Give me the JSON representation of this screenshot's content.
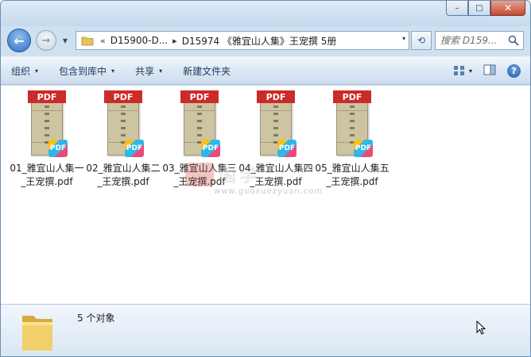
{
  "window": {
    "caption": {
      "minimize": "–",
      "maximize": "□",
      "close": "✕"
    }
  },
  "nav": {
    "back_glyph": "←",
    "forward_glyph": "→",
    "history_glyph": "▼"
  },
  "address": {
    "overflow": "«",
    "breadcrumbs": [
      "D15900-D...",
      "D15974 《雅宜山人集》王宠撰 5册"
    ],
    "separator": "▸",
    "dropdown_glyph": "▾"
  },
  "refresh_glyph": "⟲",
  "search": {
    "placeholder": "搜索 D159..."
  },
  "toolbar": {
    "items": [
      {
        "label": "组织",
        "has_dropdown": true
      },
      {
        "label": "包含到库中",
        "has_dropdown": true
      },
      {
        "label": "共享",
        "has_dropdown": true
      },
      {
        "label": "新建文件夹",
        "has_dropdown": false
      }
    ],
    "view_dropdown_glyph": "▾",
    "help_glyph": "?"
  },
  "files": [
    {
      "name": "01_雅宜山人集一_王宠撰.pdf",
      "type_label": "PDF",
      "badge": "PDF"
    },
    {
      "name": "02_雅宜山人集二_王宠撰.pdf",
      "type_label": "PDF",
      "badge": "PDF"
    },
    {
      "name": "03_雅宜山人集三_王宠撰.pdf",
      "type_label": "PDF",
      "badge": "PDF"
    },
    {
      "name": "04_雅宜山人集四_王宠撰.pdf",
      "type_label": "PDF",
      "badge": "PDF"
    },
    {
      "name": "05_雅宜山人集五_王宠撰.pdf",
      "type_label": "PDF",
      "badge": "PDF"
    }
  ],
  "watermark": {
    "text": "国学",
    "url": "www.guoxuezyuan.com"
  },
  "details": {
    "count_text": "5 个对象"
  },
  "colors": {
    "accent": "#2d6fbf",
    "pdf_red": "#cd2a2a",
    "folder": "#e8c25a"
  }
}
